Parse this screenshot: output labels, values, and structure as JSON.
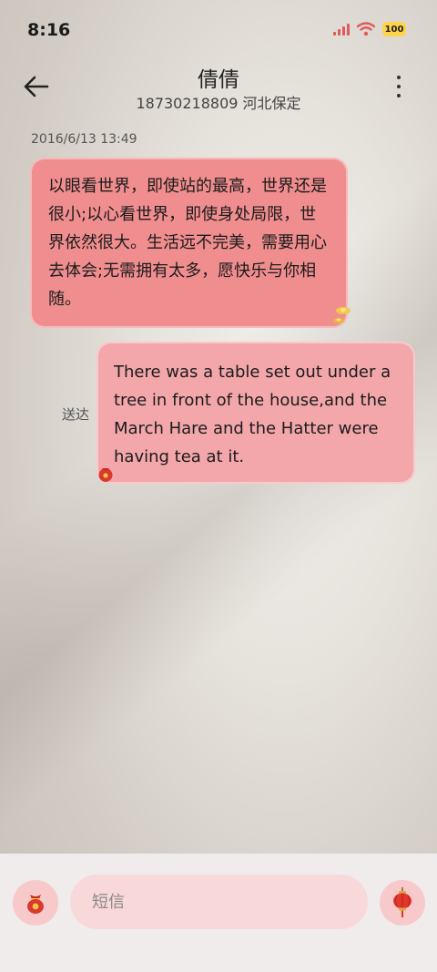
{
  "status_bar": {
    "time": "8:16",
    "battery": "100",
    "icons": [
      "signal-icon",
      "wifi-icon",
      "battery-icon"
    ]
  },
  "header": {
    "contact_name": "倩倩",
    "contact_sub": "18730218809 河北保定",
    "back_icon": "back-arrow-icon",
    "more_icon": "more-vertical-icon"
  },
  "conversation": {
    "timestamp": "2016/6/13 13:49",
    "messages": [
      {
        "direction": "incoming",
        "text": "以眼看世界，即使站的最高，世界还是很小;以心看世界，即使身处局限，世界依然很大。生活远不完美，需要用心去体会;无需拥有太多，愿快乐与你相随。"
      },
      {
        "direction": "outgoing",
        "text": "There was a table set out under a tree in front of the house,and the March Hare and the Hatter were having tea at it.",
        "status": "送达"
      }
    ]
  },
  "composer": {
    "placeholder": "短信",
    "attach_icon": "lucky-bag-icon",
    "send_icon": "lantern-icon"
  },
  "colors": {
    "incoming_bubble": "#f08d8e",
    "outgoing_bubble": "#f3a7ab",
    "composer_bg": "#efeceb",
    "input_bg": "#f9d8da"
  }
}
